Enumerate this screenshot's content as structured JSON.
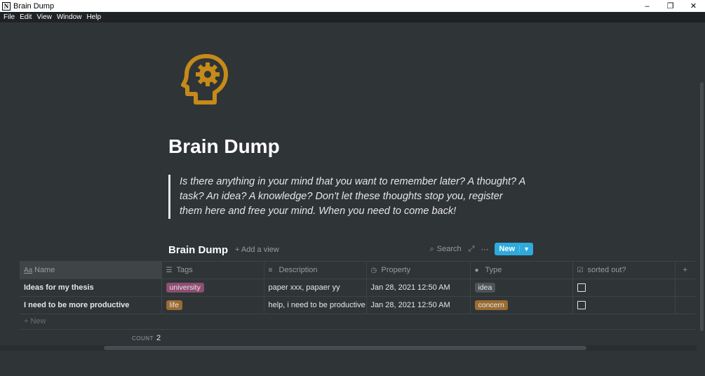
{
  "window": {
    "app_icon": "N",
    "title": "Brain Dump",
    "controls": {
      "minimize": "–",
      "restore": "❐",
      "close": "✕"
    }
  },
  "menu": [
    "File",
    "Edit",
    "View",
    "Window",
    "Help"
  ],
  "page": {
    "icon": "head-gear-icon",
    "icon_color": "#c68a19",
    "title": "Brain Dump",
    "quote": "Is there anything in your mind that you want to remember later? A thought? A task? An idea? A knowledge? Don't let these thoughts stop you, register them here and free your mind. When you need to come back!"
  },
  "database": {
    "title": "Brain Dump",
    "add_view": "+ Add a view",
    "search": "Search",
    "new_button": "New",
    "columns": [
      {
        "icon": "Aa",
        "label": "Name"
      },
      {
        "icon": "☰",
        "label": "Tags"
      },
      {
        "icon": "≡",
        "label": "Description"
      },
      {
        "icon": "◷",
        "label": "Property"
      },
      {
        "icon": "●",
        "label": "Type"
      },
      {
        "icon": "☑",
        "label": "sorted out?"
      },
      {
        "icon": "",
        "label": "+"
      }
    ],
    "rows": [
      {
        "name": "Ideas for my thesis",
        "tag": "university",
        "tag_color": "#8f4d73",
        "description": "paper xxx, papaer yy",
        "property": "Jan 28, 2021 12:50 AM",
        "type": "idea",
        "type_color": "#4d5357",
        "sorted_out": false
      },
      {
        "name": "I need to be more productive",
        "tag": "life",
        "tag_color": "#9a6b33",
        "description": "help, i need to be productive",
        "property": "Jan 28, 2021 12:50 AM",
        "type": "concern",
        "type_color": "#9a6b33",
        "sorted_out": false
      }
    ],
    "new_row": "+ New",
    "count_label": "COUNT",
    "count_value": "2"
  }
}
